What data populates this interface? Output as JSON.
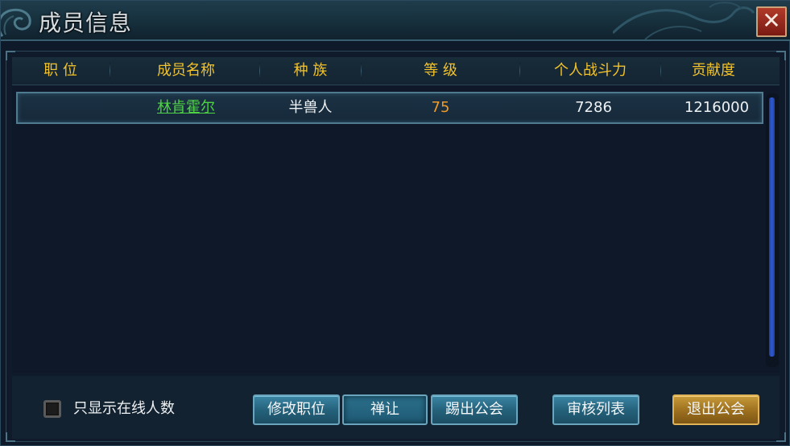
{
  "window": {
    "title": "成员信息",
    "close_label": "X"
  },
  "table": {
    "headers": [
      "职 位",
      "成员名称",
      "种 族",
      "等 级",
      "个人战斗力",
      "贡献度"
    ],
    "rows": [
      {
        "position": "",
        "name": "林肯霍尔",
        "race": "半兽人",
        "level": "75",
        "combat_power": "7286",
        "contribution": "1216000"
      }
    ]
  },
  "footer": {
    "online_only_label": "只显示在线人数",
    "online_only_checked": false,
    "buttons": {
      "modify_position": "修改职位",
      "abdicate": "禅让",
      "kick": "踢出公会",
      "review_list": "审核列表",
      "leave_guild": "退出公会"
    }
  },
  "colors": {
    "header_text": "#f2c22a",
    "name_text": "#4fd245",
    "level_text": "#f09a24",
    "leave_button": "#c79a3a",
    "close_button": "#b23a2a"
  }
}
